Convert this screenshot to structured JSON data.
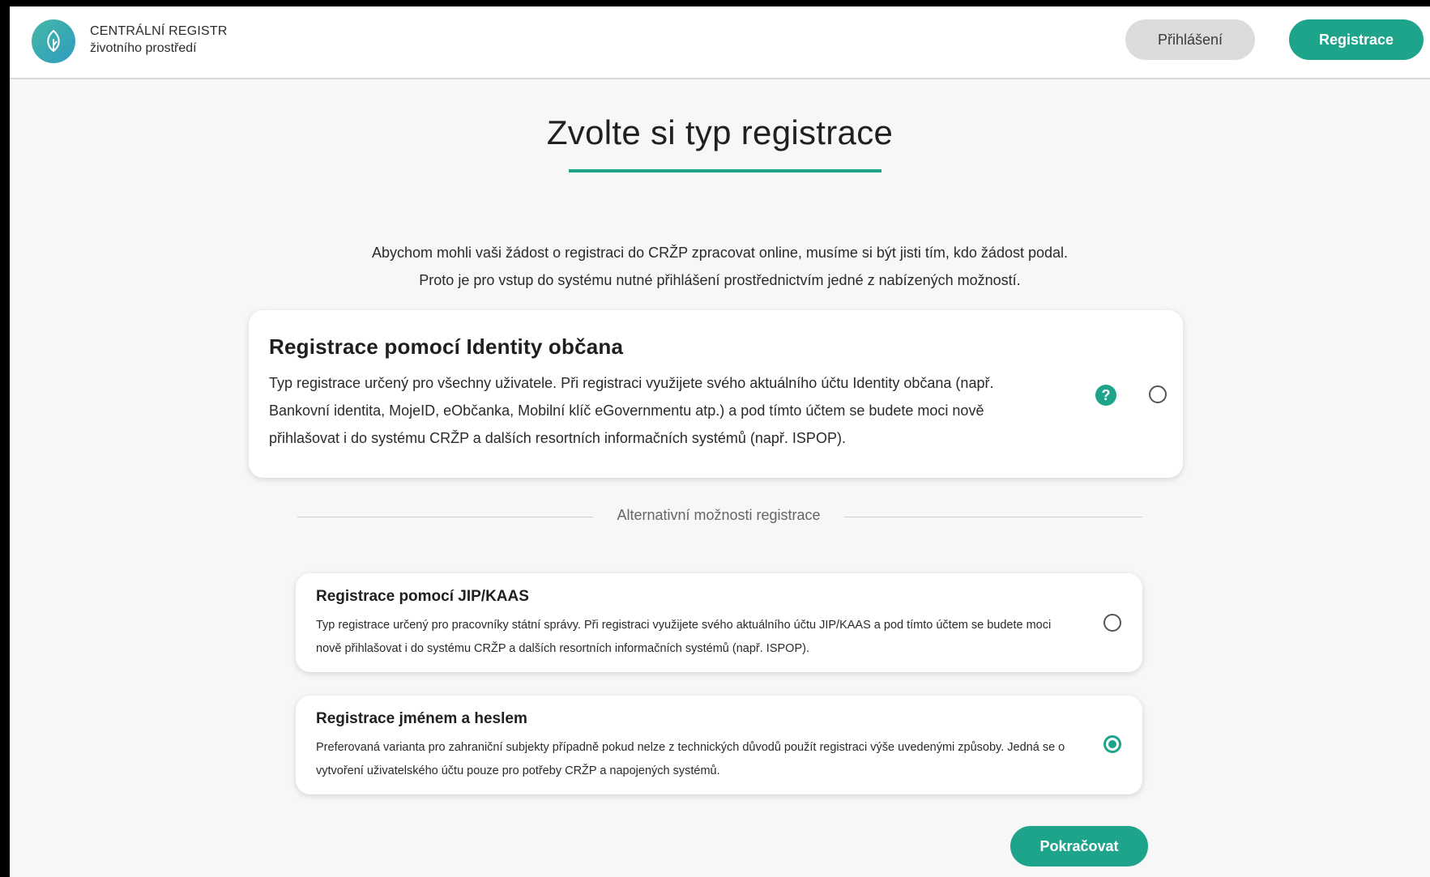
{
  "header": {
    "brand_line1": "CENTRÁLNÍ REGISTR",
    "brand_line2": "životního prostředí",
    "login_label": "Přihlášení",
    "register_label": "Registrace"
  },
  "main": {
    "title": "Zvolte si typ registrace",
    "intro_line1": "Abychom mohli vaši žádost o registraci do CRŽP zpracovat online, musíme si být jisti tím, kdo žádost podal.",
    "intro_line2": "Proto je pro vstup do systému nutné přihlášení prostřednictvím jedné z nabízených možností.",
    "primary_option": {
      "title": "Registrace pomocí Identity občana",
      "description": "Typ registrace určený pro všechny uživatele. Při registraci využijete svého aktuálního účtu Identity občana (např. Bankovní identita, MojeID, eObčanka, Mobilní klíč eGovernmentu atp.) a pod tímto účtem se budete moci nově přihlašovat i do systému CRŽP a dalších resortních informačních systémů (např. ISPOP).",
      "help_symbol": "?",
      "selected": false
    },
    "separator_label": "Alternativní možnosti registrace",
    "alternative_options": [
      {
        "title": "Registrace pomocí JIP/KAAS",
        "description": "Typ registrace určený pro pracovníky státní správy. Při registraci využijete svého aktuálního účtu JIP/KAAS a pod tímto účtem se budete moci nově přihlašovat i do systému CRŽP a dalších resortních informačních systémů (např. ISPOP).",
        "selected": false
      },
      {
        "title": "Registrace jménem a heslem",
        "description": "Preferovaná varianta pro zahraniční subjekty případně pokud nelze z technických důvodů použít registraci výše uvedenými způsoby. Jedná se o vytvoření uživatelského účtu pouze pro potřeby CRŽP a napojených systémů.",
        "selected": true
      }
    ],
    "continue_label": "Pokračovat"
  },
  "colors": {
    "accent": "#1fa48c",
    "login_button_bg": "#dcdcdc"
  },
  "icons": {
    "logo": "leaf-logo-icon",
    "help": "help-circle-icon"
  }
}
